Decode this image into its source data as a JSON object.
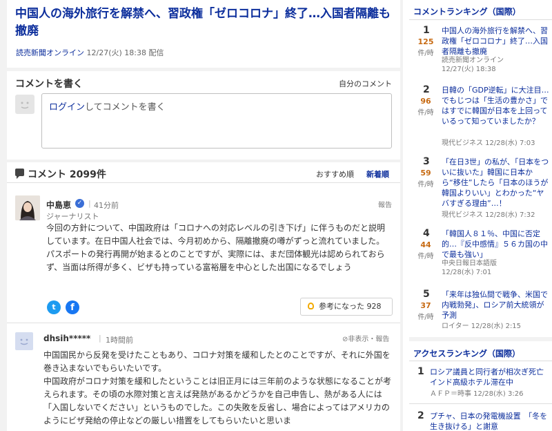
{
  "article": {
    "title": "中国人の海外旅行を解禁へ、習政権「ゼロコロナ」終了…入国者隔離も撤廃",
    "source": "読売新聞オンライン",
    "date": "12/27(火) 18:38 配信"
  },
  "comment_form": {
    "title": "コメントを書く",
    "my_comments_link": "自分のコメント",
    "login_label": "ログイン",
    "prompt_suffix": "してコメントを書く"
  },
  "comments": {
    "title": "コメント 2099件",
    "sort_recommended": "おすすめ順",
    "sort_newest": "新着順",
    "items": [
      {
        "name": "中島恵",
        "time": "41分前",
        "role": "ジャーナリスト",
        "report": "報告",
        "body": "今回の方針について、中国政府は「コロナへの対応レベルの引き下げ」に伴うものだと説明しています。在日中国人社会では、今月初めから、隔離撤廃の噂がずっと流れていました。パスポートの発行再開が始まるとのことですが、実際には、まだ団体観光は認められておらず、当面は所得が多く、ビザも持っている富裕層を中心とした出国になるでしょう",
        "helpful_label": "参考になった",
        "helpful_count": "928"
      },
      {
        "name": "dhsih*****",
        "time": "1時間前",
        "hide": "⊘非表示・報告",
        "body": "中国国民から反発を受けたこともあり、コロナ対策を緩和したとのことですが、それに外国を巻き込まないでもらいたいです。\n中国政府がコロナ対策を緩和したということは旧正月には三年前のような状態になることが考えられます。その頃の水際対策と言えば発熱があるかどうかを自己申告し、熱がある人には「入国しないでください」というものでした。この失敗を反省し、場合によってはアメリカのようにビザ発給の停止などの厳しい措置をしてもらいたいと思いま"
      }
    ]
  },
  "sidebar": {
    "comment_ranking_title": "コメントランキング（国際）",
    "comment_ranking": [
      {
        "rank": "1",
        "count": "125",
        "unit": "件/時",
        "title": "中国人の海外旅行を解禁へ、習政権「ゼロコロナ」終了…入国者隔離も撤廃",
        "source": "読売新聞オンライン\n12/27(火) 18:38"
      },
      {
        "rank": "2",
        "count": "96",
        "unit": "件/時",
        "title": "日韓の「GDP逆転」に大注目…でもじつは「生活の豊かさ」ではすでに韓国が日本を上回っているって知っていましたか？",
        "source": "現代ビジネス 12/28(水) 7:03"
      },
      {
        "rank": "3",
        "count": "59",
        "unit": "件/時",
        "title": "「在日3世」の私が、「日本をついに抜いた」韓国に日本から“移住”したら「日本のほうが韓国よりいい」とわかった“ヤバすぎる理由”…！",
        "source": "現代ビジネス 12/28(水) 7:32"
      },
      {
        "rank": "4",
        "count": "44",
        "unit": "件/時",
        "title": "「韓国人８１％、中国に否定的…『反中感情』５６カ国の中で最も強い」",
        "source": "中央日報日本語版\n12/28(水) 7:01"
      },
      {
        "rank": "5",
        "count": "37",
        "unit": "件/時",
        "title": "「来年は独仏間で戦争、米国で内戦勃発」、ロシア前大統領が予測",
        "source": "ロイター 12/28(水) 2:15"
      }
    ],
    "access_ranking_title": "アクセスランキング（国際）",
    "access_ranking": [
      {
        "rank": "1",
        "title": "ロシア議員と同行者が相次ぎ死亡 インド高級ホテル滞在中",
        "source": "ＡＦＰ＝時事 12/28(水) 3:26"
      },
      {
        "rank": "2",
        "title": "プチャ、日本の発電機設置　「冬を生き抜ける」と謝意",
        "source": ""
      }
    ]
  }
}
